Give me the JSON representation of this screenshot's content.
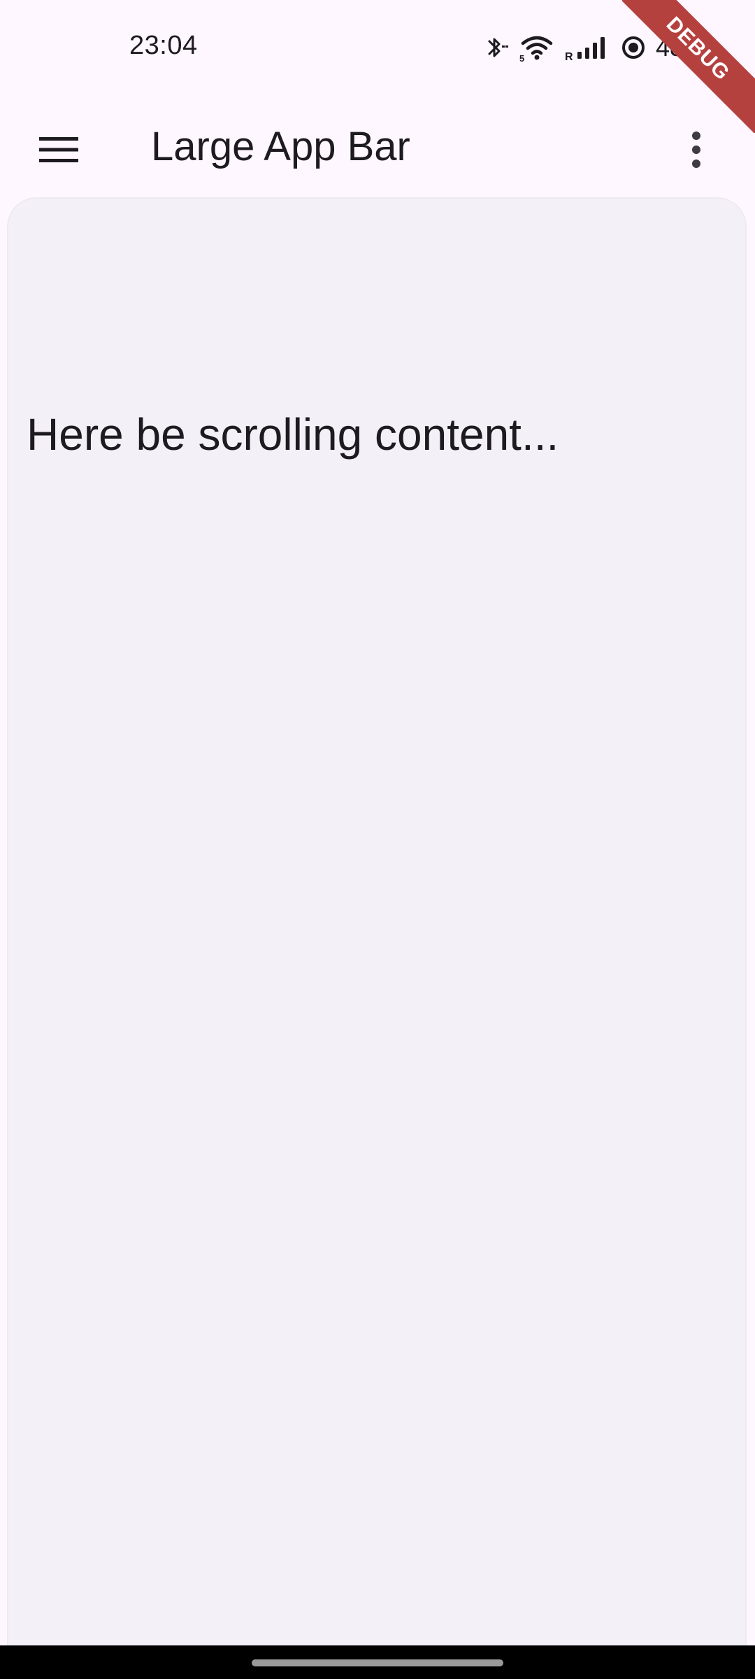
{
  "status_bar": {
    "time": "23:04",
    "battery_percent": "48%",
    "icons": [
      "bluetooth-icon",
      "wifi-icon",
      "signal-icon",
      "data-saver-icon"
    ],
    "network_badge_wifi": "5",
    "network_badge_signal": "R"
  },
  "app_bar": {
    "title": "Large App Bar",
    "leading_icon": "menu-icon",
    "trailing_icon": "more-vert-icon"
  },
  "content": {
    "text": "Here be scrolling content..."
  },
  "debug_banner": {
    "label": "DEBUG",
    "color": "#B5413F"
  },
  "colors": {
    "background": "#FEF7FF",
    "card": "#F4F0F7",
    "on_surface": "#1D1B20"
  }
}
